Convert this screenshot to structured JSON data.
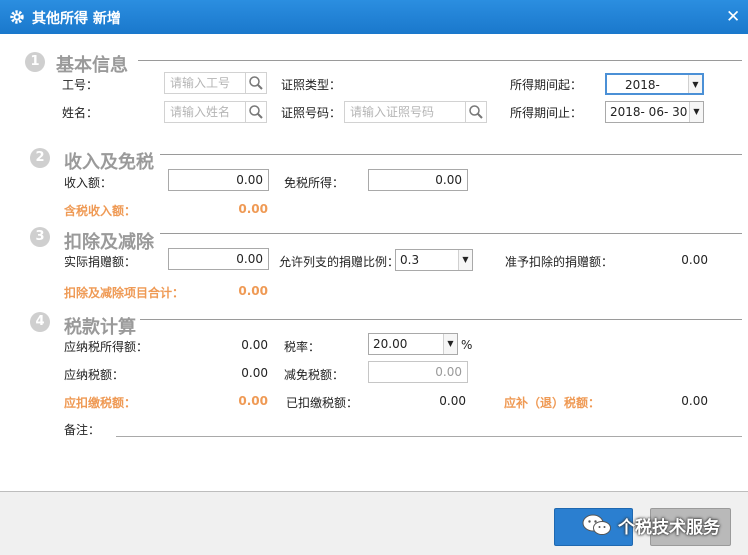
{
  "window": {
    "title": "其他所得 新增",
    "close_glyph": "✕"
  },
  "sections": [
    {
      "num": "1",
      "title": "基本信息"
    },
    {
      "num": "2",
      "title": "收入及免税"
    },
    {
      "num": "3",
      "title": "扣除及减除"
    },
    {
      "num": "4",
      "title": "税款计算"
    }
  ],
  "basic": {
    "employee_id_label": "工号：",
    "employee_id_placeholder": "请输入工号",
    "id_type_label": "证照类型：",
    "period_start_label": "所得期间起：",
    "period_start_value": "2018-",
    "name_label": "姓名：",
    "name_placeholder": "请输入姓名",
    "id_number_label": "证照号码：",
    "id_number_placeholder": "请输入证照号码",
    "period_end_label": "所得期间止：",
    "period_end_value": "2018-  06-  30"
  },
  "income": {
    "income_label": "收入额：",
    "income_value": "0.00",
    "exempt_label": "免税所得：",
    "exempt_value": "0.00",
    "taxable_income_label": "含税收入额：",
    "taxable_income_value": "0.00"
  },
  "deduction": {
    "donation_label": "实际捐赠额：",
    "donation_value": "0.00",
    "ratio_label": "允许列支的捐赠比例：",
    "ratio_value": "0.3",
    "allowed_label": "准予扣除的捐赠额：",
    "allowed_value": "0.00",
    "total_label": "扣除及减除项目合计：",
    "total_value": "0.00"
  },
  "tax": {
    "taxable_label": "应纳税所得额：",
    "taxable_value": "0.00",
    "rate_label": "税率：",
    "rate_value": "20.00",
    "rate_unit": "%",
    "payable_label": "应纳税额：",
    "payable_value": "0.00",
    "relief_label": "减免税额：",
    "relief_value": "0.00",
    "withhold_label": "应扣缴税额：",
    "withhold_value": "0.00",
    "paid_label": "已扣缴税额：",
    "paid_value": "0.00",
    "refund_label": "应补（退）税额：",
    "refund_value": "0.00",
    "remarks_label": "备注："
  },
  "watermark": {
    "text": "个税技术服务"
  },
  "colors": {
    "titlebar": "#1f80d4",
    "accent_orange": "#ef9a55",
    "section_gray": "#9a9a9a",
    "save_button": "#2b7fd0"
  }
}
